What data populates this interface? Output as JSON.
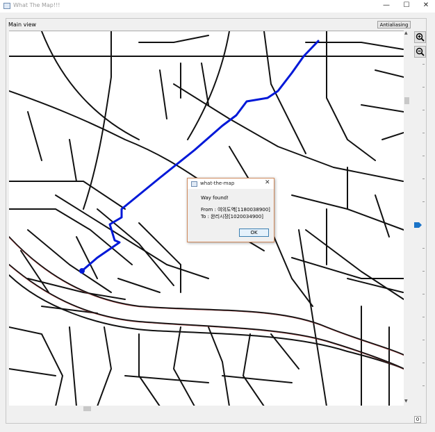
{
  "window": {
    "title": "What The Map!!!",
    "controls": {
      "minimize": "—",
      "maximize": "☐",
      "close": "✕"
    }
  },
  "main_view": {
    "label": "Main view",
    "antialiasing_button": "Antialiasing"
  },
  "zoom": {
    "zoom_in_icon": "zoom-in-icon",
    "zoom_out_icon": "zoom-out-icon",
    "level_display": "0"
  },
  "dialog": {
    "title": "what-the-map",
    "close": "✕",
    "message": "Way found!",
    "from": "From : 여의도역[1180038900]",
    "to": "To : 완리시장[1020034900]",
    "ok_label": "OK"
  },
  "colors": {
    "route": "#0018d8",
    "road": "#111111",
    "road_edge": "#c04040",
    "map_background": "#ffffff",
    "dialog_border": "#d08a5c",
    "ok_border": "#3c7fb1",
    "zoom_handle": "#1a73c7"
  }
}
